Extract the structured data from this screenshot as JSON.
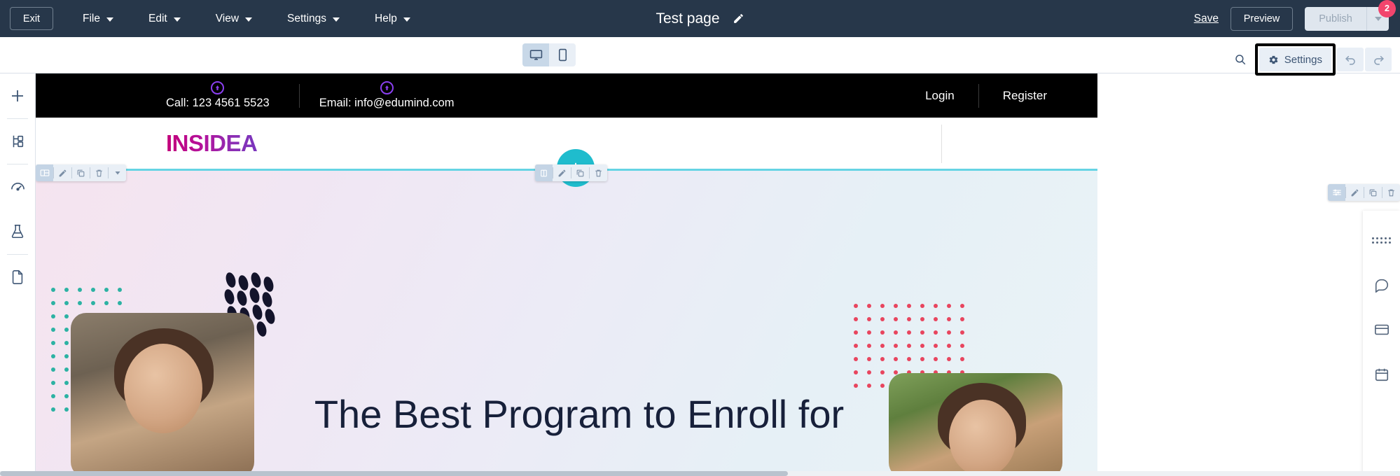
{
  "topbar": {
    "exit_label": "Exit",
    "menus": [
      {
        "label": "File",
        "icon": "chevron-down-icon"
      },
      {
        "label": "Edit",
        "icon": "chevron-down-icon"
      },
      {
        "label": "View",
        "icon": "chevron-down-icon"
      },
      {
        "label": "Settings",
        "icon": "chevron-down-icon"
      },
      {
        "label": "Help",
        "icon": "chevron-down-icon"
      }
    ],
    "page_title": "Test page",
    "title_edit_icon": "pencil-icon",
    "save_label": "Save",
    "preview_label": "Preview",
    "publish_label": "Publish",
    "publish_caret_icon": "chevron-down-icon",
    "notification_count": "2",
    "bg_color": "#27374a",
    "badge_color": "#f2456d"
  },
  "subbar": {
    "devices": [
      {
        "name": "desktop-view",
        "icon": "monitor-icon",
        "active": true
      },
      {
        "name": "mobile-view",
        "icon": "phone-icon",
        "active": false
      }
    ],
    "search_icon": "search-icon",
    "settings_label": "Settings",
    "settings_icon": "gear-icon",
    "undo_icon": "undo-icon",
    "redo_icon": "redo-icon",
    "settings_highlighted": true
  },
  "left_rail": [
    {
      "name": "add",
      "icon": "plus-icon"
    },
    {
      "name": "sections",
      "icon": "sitemap-icon"
    },
    {
      "name": "performance",
      "icon": "gauge-icon"
    },
    {
      "name": "experiments",
      "icon": "flask-icon"
    },
    {
      "name": "pages",
      "icon": "document-icon"
    }
  ],
  "site": {
    "contacts": [
      {
        "icon": "arrow-up-circle-icon",
        "text": "Call: 123 4561 5523"
      },
      {
        "icon": "arrow-up-circle-icon",
        "text": "Email: info@edumind.com"
      }
    ],
    "nav": [
      {
        "label": "Login"
      },
      {
        "label": "Register"
      }
    ],
    "logo_text": "INSIDEA",
    "hero_heading": "The Best Program to Enroll for"
  },
  "element_toolbars": [
    {
      "name": "section-toolbar",
      "items": [
        {
          "icon": "layout-icon",
          "selected": true
        },
        {
          "icon": "pencil-icon"
        },
        {
          "icon": "copy-icon"
        },
        {
          "icon": "trash-icon"
        },
        {
          "icon": "chevron-down-icon"
        }
      ]
    },
    {
      "name": "column-toolbar",
      "items": [
        {
          "icon": "columns-icon",
          "selected": true
        },
        {
          "icon": "pencil-icon"
        },
        {
          "icon": "copy-icon"
        },
        {
          "icon": "trash-icon"
        }
      ]
    },
    {
      "name": "widget-toolbar",
      "items": [
        {
          "icon": "sliders-icon",
          "selected": true
        },
        {
          "icon": "pencil-icon"
        },
        {
          "icon": "copy-icon"
        },
        {
          "icon": "trash-icon"
        }
      ]
    }
  ],
  "widget_rail": [
    {
      "name": "drag-handle",
      "icon": "grid-dots-icon"
    },
    {
      "name": "chat-widget",
      "icon": "chat-icon"
    },
    {
      "name": "banner-widget",
      "icon": "window-icon"
    },
    {
      "name": "calendar-widget",
      "icon": "calendar-icon"
    }
  ],
  "colors": {
    "topbar_bg": "#27374a",
    "accent_teal": "#1fbccd",
    "accent_purple": "#8a3ff0",
    "selection": "#66d4e4",
    "toolbar_bg": "#e9eff6",
    "toolbar_text": "#3d5574"
  }
}
